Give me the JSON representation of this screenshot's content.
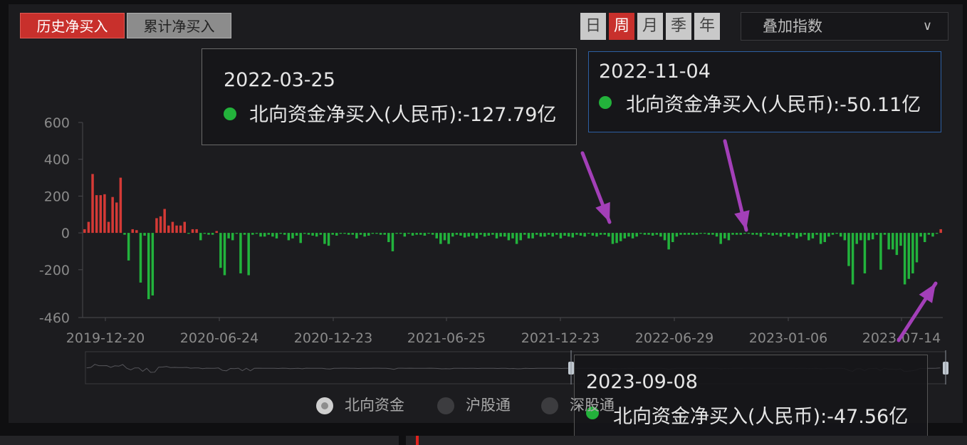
{
  "tabs": {
    "history": "历史净买入",
    "cumulative": "累计净买入"
  },
  "periods": [
    "日",
    "周",
    "月",
    "季",
    "年"
  ],
  "active_period": "周",
  "overlay_dropdown": {
    "label": "叠加指数",
    "chevron_icon": "chevron-down-icon"
  },
  "chart_data": {
    "type": "bar",
    "y_ticks": [
      "600",
      "400",
      "200",
      "0",
      "-200",
      "-460"
    ],
    "x_ticks": [
      "2019-12-20",
      "2020-06-24",
      "2020-12-23",
      "2021-06-25",
      "2021-12-23",
      "2022-06-29",
      "2023-01-06",
      "2023-07-14"
    ],
    "ylim": [
      -460,
      600
    ],
    "colors": {
      "positive": "#d53a36",
      "negative": "#22b33c"
    },
    "values": [
      20,
      60,
      320,
      205,
      205,
      210,
      60,
      195,
      165,
      300,
      -10,
      -150,
      20,
      15,
      -270,
      -15,
      -360,
      -340,
      80,
      90,
      130,
      40,
      60,
      40,
      40,
      60,
      -5,
      20,
      20,
      -40,
      -5,
      -10,
      -10,
      10,
      -190,
      -230,
      -30,
      -40,
      -5,
      -220,
      -10,
      -230,
      -10,
      -5,
      -20,
      -20,
      -10,
      -20,
      -30,
      -5,
      -10,
      -40,
      -30,
      -15,
      -55,
      -5,
      -10,
      -15,
      -20,
      -10,
      -60,
      -70,
      -10,
      -15,
      -5,
      -5,
      -10,
      -10,
      -30,
      -10,
      -20,
      -15,
      -5,
      -5,
      -10,
      -10,
      -50,
      -100,
      -5,
      -5,
      -20,
      -5,
      -15,
      -10,
      -10,
      -15,
      -5,
      -10,
      -30,
      -60,
      -40,
      -60,
      -20,
      -10,
      -15,
      -25,
      -20,
      -15,
      -30,
      -10,
      -20,
      -15,
      -10,
      -30,
      -20,
      -20,
      -40,
      -30,
      -60,
      -40,
      -10,
      -30,
      -30,
      -10,
      -20,
      -20,
      -10,
      -20,
      -10,
      -30,
      -15,
      -20,
      -25,
      -10,
      -15,
      -20,
      -5,
      -15,
      -20,
      -10,
      -10,
      -20,
      -60,
      -55,
      -45,
      -30,
      -20,
      -30,
      -20,
      -5,
      -10,
      -10,
      -15,
      -10,
      -20,
      -40,
      -90,
      -50,
      -20,
      -10,
      -10,
      -10,
      -10,
      -10,
      -5,
      -5,
      -10,
      -10,
      -20,
      -60,
      -30,
      -40,
      -10,
      -10,
      -10,
      -5,
      -5,
      -10,
      -10,
      -20,
      -5,
      -10,
      -15,
      -10,
      -20,
      -10,
      -20,
      -10,
      -30,
      -20,
      -10,
      -40,
      -30,
      -10,
      -60,
      -50,
      -20,
      -10,
      -5,
      -20,
      -40,
      -180,
      -280,
      -60,
      -40,
      -220,
      -40,
      -35,
      -10,
      -200,
      -10,
      -90,
      -90,
      -120,
      -70,
      -280,
      -250,
      -220,
      -160,
      -20,
      -50,
      -10,
      -20,
      -5,
      20
    ],
    "series_positive_name": "北向资金净买入(人民币)"
  },
  "tooltips": [
    {
      "date": "2022-03-25",
      "label": "北向资金净买入(人民币):-127.79亿"
    },
    {
      "date": "2022-11-04",
      "label": "北向资金净买入(人民币):-50.11亿"
    },
    {
      "date": "2023-09-08",
      "label": "北向资金净买入(人民币):-47.56亿"
    }
  ],
  "legend_radios": [
    {
      "label": "北向资金",
      "selected": true
    },
    {
      "label": "沪股通",
      "selected": false
    },
    {
      "label": "深股通",
      "selected": false
    }
  ]
}
